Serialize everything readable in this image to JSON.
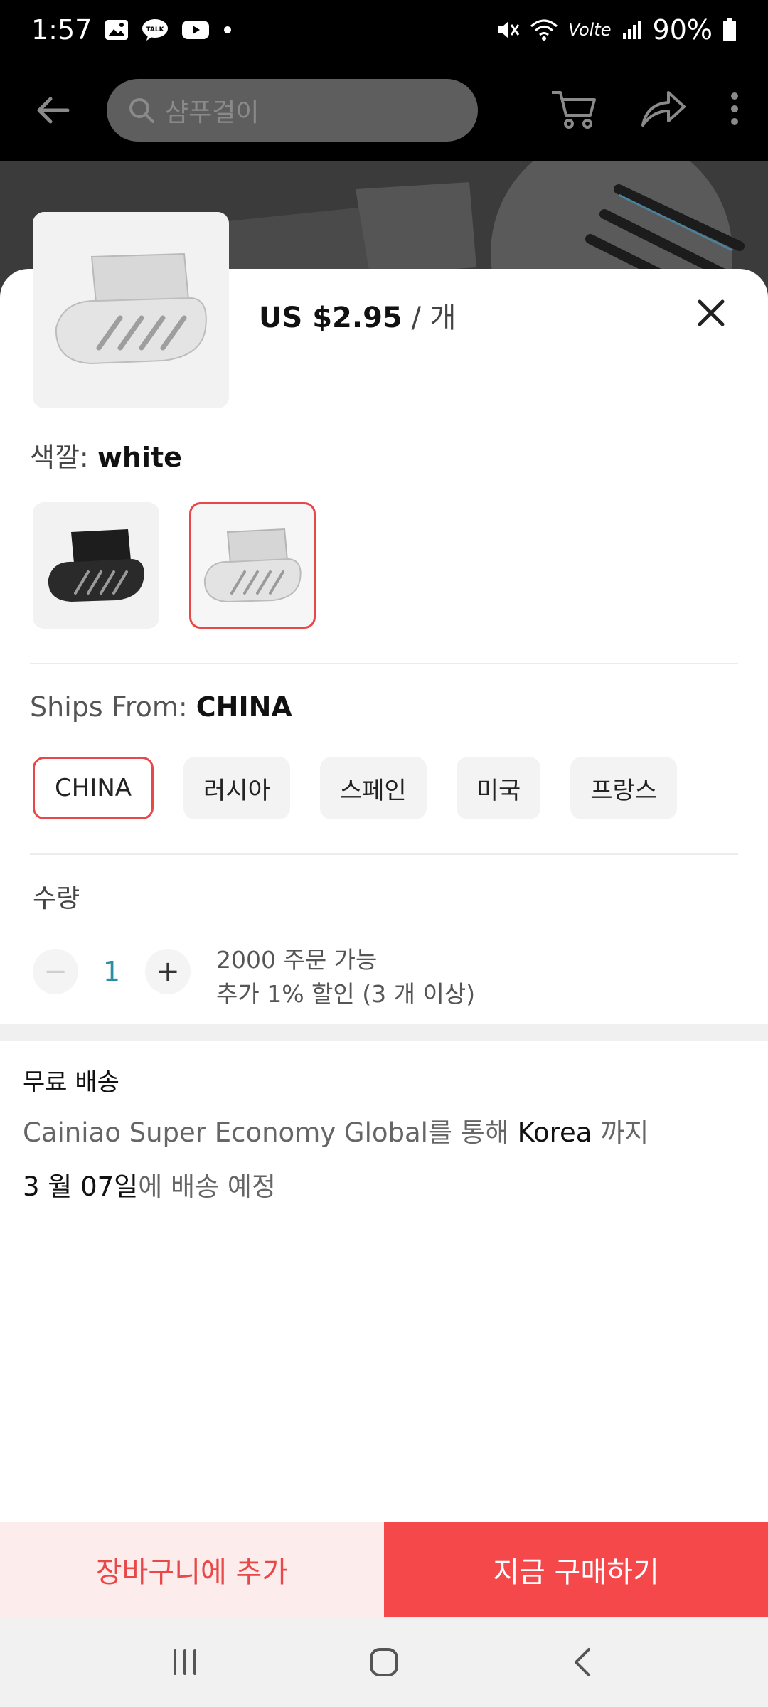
{
  "status_bar": {
    "time": "1:57",
    "battery": "90%",
    "network": "Volte"
  },
  "header": {
    "search_placeholder": "샴푸걸이"
  },
  "product": {
    "price": "US $2.95",
    "unit": " / 개"
  },
  "color": {
    "label": "색깔: ",
    "value": "white",
    "options": [
      "black",
      "white"
    ],
    "selected_index": 1
  },
  "ships_from": {
    "label": "Ships From: ",
    "value": "CHINA",
    "options": [
      "CHINA",
      "러시아",
      "스페인",
      "미국",
      "프랑스"
    ],
    "selected_index": 0
  },
  "quantity": {
    "label": "수량",
    "value": "1",
    "minus": "−",
    "plus": "+",
    "available": "2000 주문 가능",
    "discount": "추가 1% 할인 (3 개 이상)"
  },
  "shipping": {
    "title": "무료 배송",
    "route_prefix": "Cainiao Super Economy Global를 통해 ",
    "destination": "Korea",
    "route_suffix": " 까지",
    "eta_date": "3 월 07일",
    "eta_suffix": "에 배송 예정"
  },
  "actions": {
    "add_to_cart": "장바구니에 추가",
    "buy_now": "지금 구매하기"
  },
  "colors": {
    "accent": "#f4484b",
    "cart_bg": "#fdecec",
    "qty_value": "#2a8fa6"
  }
}
